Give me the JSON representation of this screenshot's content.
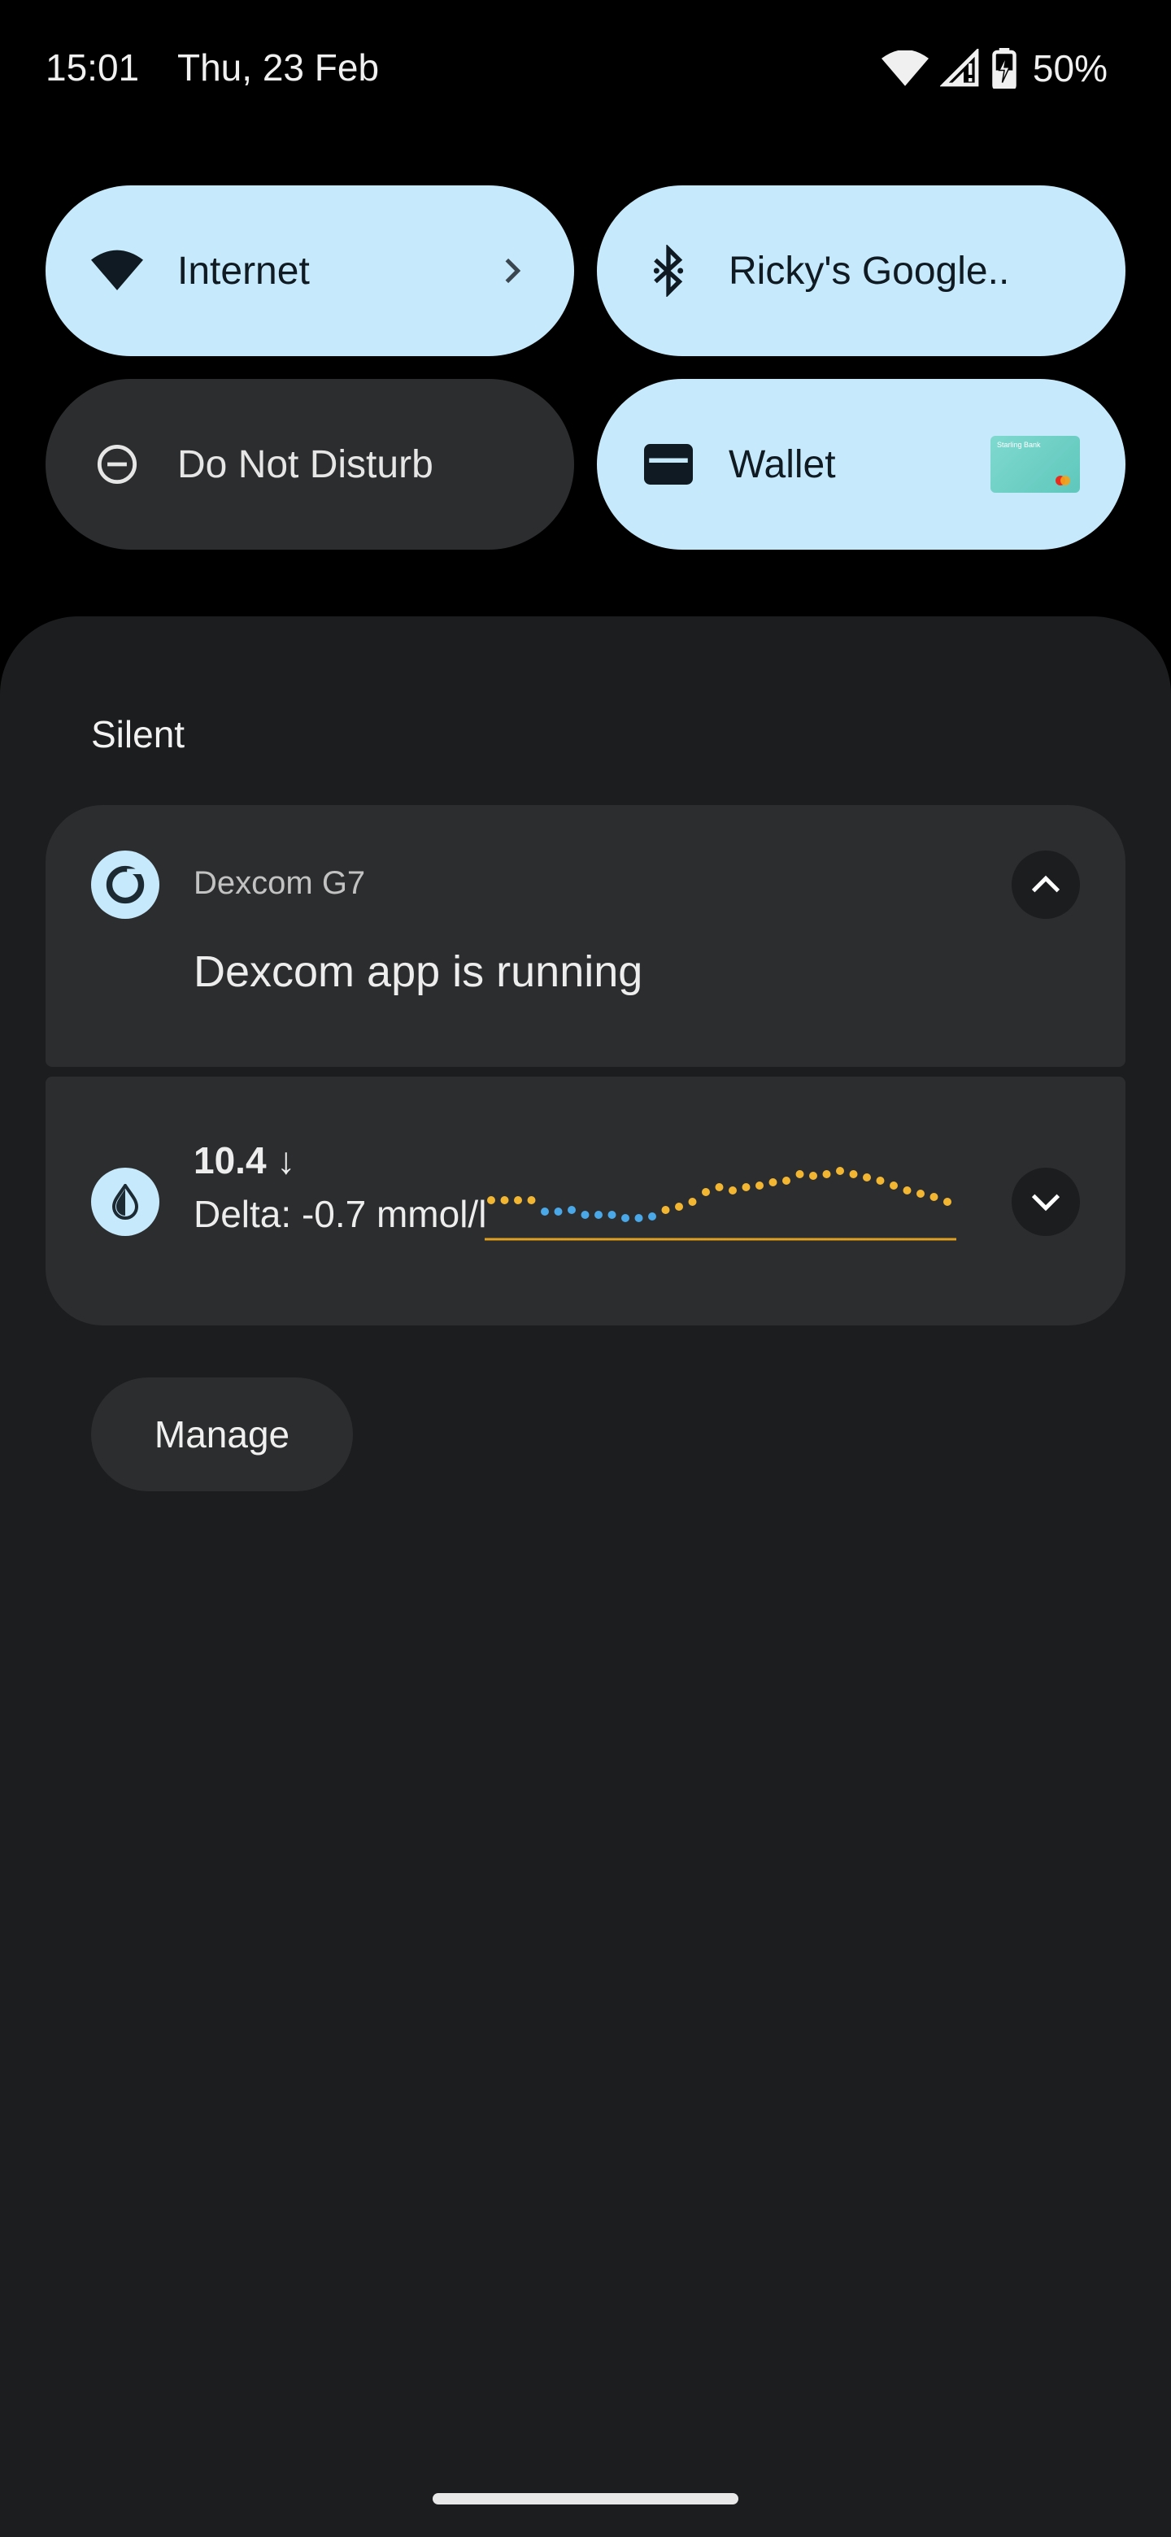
{
  "status_bar": {
    "time": "15:01",
    "date": "Thu, 23 Feb",
    "battery": "50%",
    "icons": [
      "wifi-icon",
      "signal-icon",
      "battery-charging-icon"
    ]
  },
  "tiles": {
    "internet": {
      "label": "Internet",
      "icon": "wifi-icon",
      "state": "on"
    },
    "bluetooth": {
      "label": "Ricky's Google..",
      "icon": "bluetooth-icon",
      "state": "on"
    },
    "dnd": {
      "label": "Do Not Disturb",
      "icon": "minus-circle-icon",
      "state": "off"
    },
    "wallet": {
      "label": "Wallet",
      "icon": "wallet-icon",
      "state": "on",
      "card_name": "Starling Bank"
    }
  },
  "notifications": {
    "section_header": "Silent",
    "dexcom": {
      "app_name": "Dexcom G7",
      "title": "Dexcom app is running",
      "icon": "dexcom-ring-icon",
      "expand_icon": "chevron-up-icon"
    },
    "glucose": {
      "value": "10.4 ↓",
      "delta": "Delta: -0.7 mmol/l",
      "icon": "drop-half-icon",
      "expand_icon": "chevron-down-icon"
    },
    "manage_label": "Manage"
  },
  "colors": {
    "tile_on": "#c6e9fb",
    "tile_off": "#2c2d2f",
    "shade_bg": "#1c1d1f",
    "glucose_high": "#f2b632",
    "glucose_low": "#4aa8e8",
    "target_line_high": "#e0a020",
    "target_line_low": "#8a2020"
  }
}
